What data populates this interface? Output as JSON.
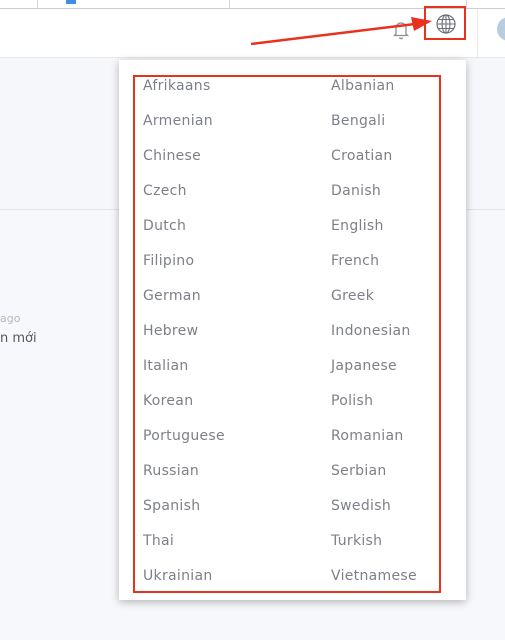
{
  "header": {
    "notification_icon": "bell-icon",
    "language_icon": "globe-icon"
  },
  "background": {
    "time_ago": "ago",
    "snippet": "n mới"
  },
  "language_menu": {
    "items": [
      "Afrikaans",
      "Albanian",
      "Armenian",
      "Bengali",
      "Chinese",
      "Croatian",
      "Czech",
      "Danish",
      "Dutch",
      "English",
      "Filipino",
      "French",
      "German",
      "Greek",
      "Hebrew",
      "Indonesian",
      "Italian",
      "Japanese",
      "Korean",
      "Polish",
      "Portuguese",
      "Romanian",
      "Russian",
      "Serbian",
      "Spanish",
      "Swedish",
      "Thai",
      "Turkish",
      "Ukrainian",
      "Vietnamese"
    ]
  },
  "colors": {
    "highlight": "#e8321e",
    "menu_text": "#7d8088",
    "page_bg": "#f4f5f9"
  }
}
